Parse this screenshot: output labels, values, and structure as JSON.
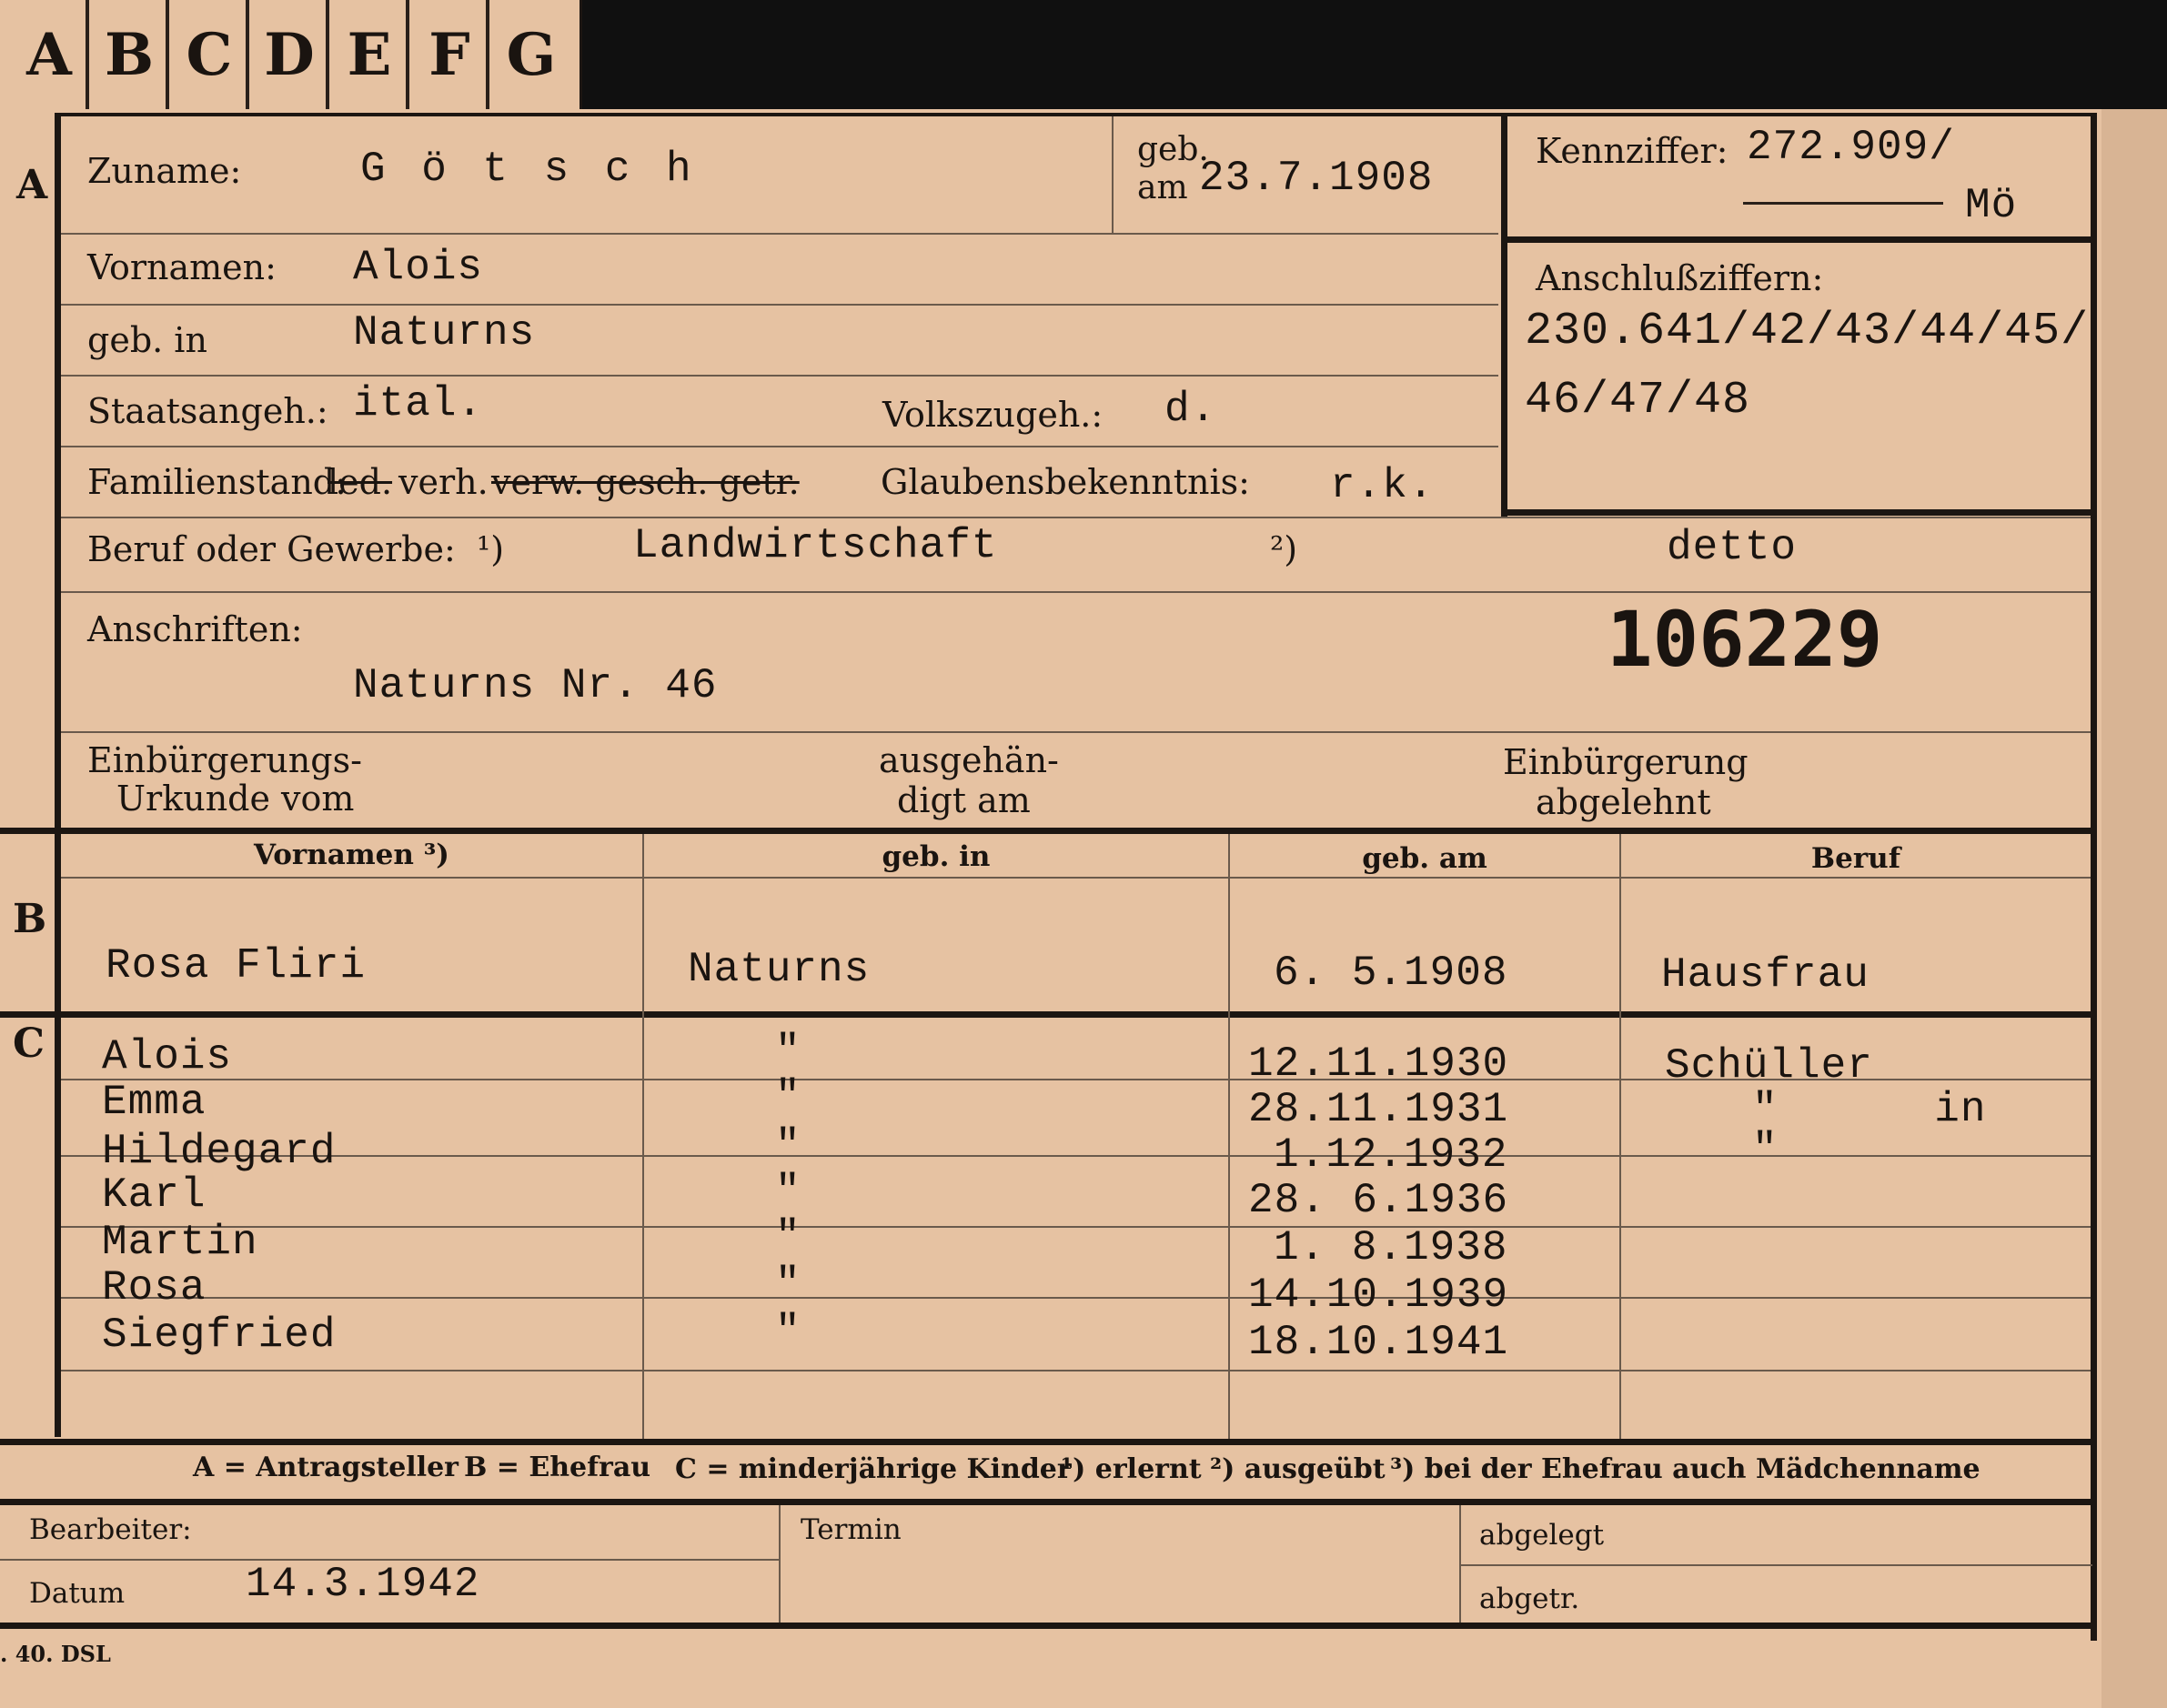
{
  "tabs": [
    "A",
    "B",
    "C",
    "D",
    "E",
    "F",
    "G"
  ],
  "section_a": {
    "marker": "A",
    "zuname_label": "Zuname:",
    "zuname_value": "G ö t s c h",
    "geb_label_1": "geb.",
    "geb_label_2": "am",
    "geb_value": "23.7.1908",
    "kennziffer_label": "Kennziffer:",
    "kennziffer_value": "272.909/",
    "kennziffer_suffix": "Mö",
    "vornamen_label": "Vornamen:",
    "vornamen_value": "Alois",
    "geb_in_label": "geb. in",
    "geb_in_value": "Naturns",
    "anschluss_label": "Anschlußziffern:",
    "anschluss_line1": "230.641/42/43/44/45/",
    "anschluss_line2": "46/47/48",
    "staats_label": "Staatsangeh.:",
    "staats_value": "ital.",
    "volks_label": "Volkszugeh.:",
    "volks_value": "d.",
    "familien_label": "Familienstand:",
    "familien_led": "led.",
    "familien_verh": "verh.",
    "familien_rest": "verw. gesch. getr.",
    "glauben_label": "Glaubensbekenntnis:",
    "glauben_value": "r.k.",
    "beruf_label": "Beruf oder Gewerbe:",
    "beruf_note1": "¹)",
    "beruf_value1": "Landwirtschaft",
    "beruf_note2": "²)",
    "beruf_value2": "detto",
    "anschriften_label": "Anschriften:",
    "anschriften_value": "Naturns Nr. 46",
    "stamp_number": "106229",
    "einb_label_1": "Einbürgerungs-",
    "einb_label_2": "Urkunde vom",
    "ausg_label_1": "ausgehän-",
    "ausg_label_2": "digt am",
    "abgel_label_1": "Einbürgerung",
    "abgel_label_2": "abgelehnt"
  },
  "section_b": {
    "marker": "B",
    "headers": [
      "Vornamen ³)",
      "geb. in",
      "geb. am",
      "Beruf"
    ],
    "row": [
      "Rosa Fliri",
      "Naturns",
      "6. 5.1908",
      "Hausfrau"
    ]
  },
  "section_c": {
    "marker": "C",
    "rows": [
      {
        "name": "Alois",
        "place": "\"",
        "date": "12.11.1930",
        "beruf": "Schüller"
      },
      {
        "name": "Emma",
        "place": "\"",
        "date": "28.11.1931",
        "beruf": "\"      in"
      },
      {
        "name": "Hildegard",
        "place": "\"",
        "date": "1.12.1932",
        "beruf": "\""
      },
      {
        "name": "Karl",
        "place": "\"",
        "date": "28. 6.1936",
        "beruf": ""
      },
      {
        "name": "Martin",
        "place": "\"",
        "date": "1. 8.1938",
        "beruf": ""
      },
      {
        "name": "Rosa",
        "place": "\"",
        "date": "14.10.1939",
        "beruf": ""
      },
      {
        "name": "Siegfried",
        "place": "\"",
        "date": "18.10.1941",
        "beruf": ""
      }
    ]
  },
  "legend": {
    "a": "A = Antragsteller",
    "b": "B = Ehefrau",
    "c": "C = minderjährige Kinder",
    "n1": "¹) erlernt",
    "n2": "²) ausgeübt",
    "n3": "³) bei der Ehefrau auch Mädchenname"
  },
  "footer": {
    "bearbeiter_label": "Bearbeiter:",
    "datum_label": "Datum",
    "datum_value": "14.3.1942",
    "termin_label": "Termin",
    "abgelegt_label": "abgelegt",
    "abgetr_label": "abgetr.",
    "print_code": ". 40. DSL"
  }
}
